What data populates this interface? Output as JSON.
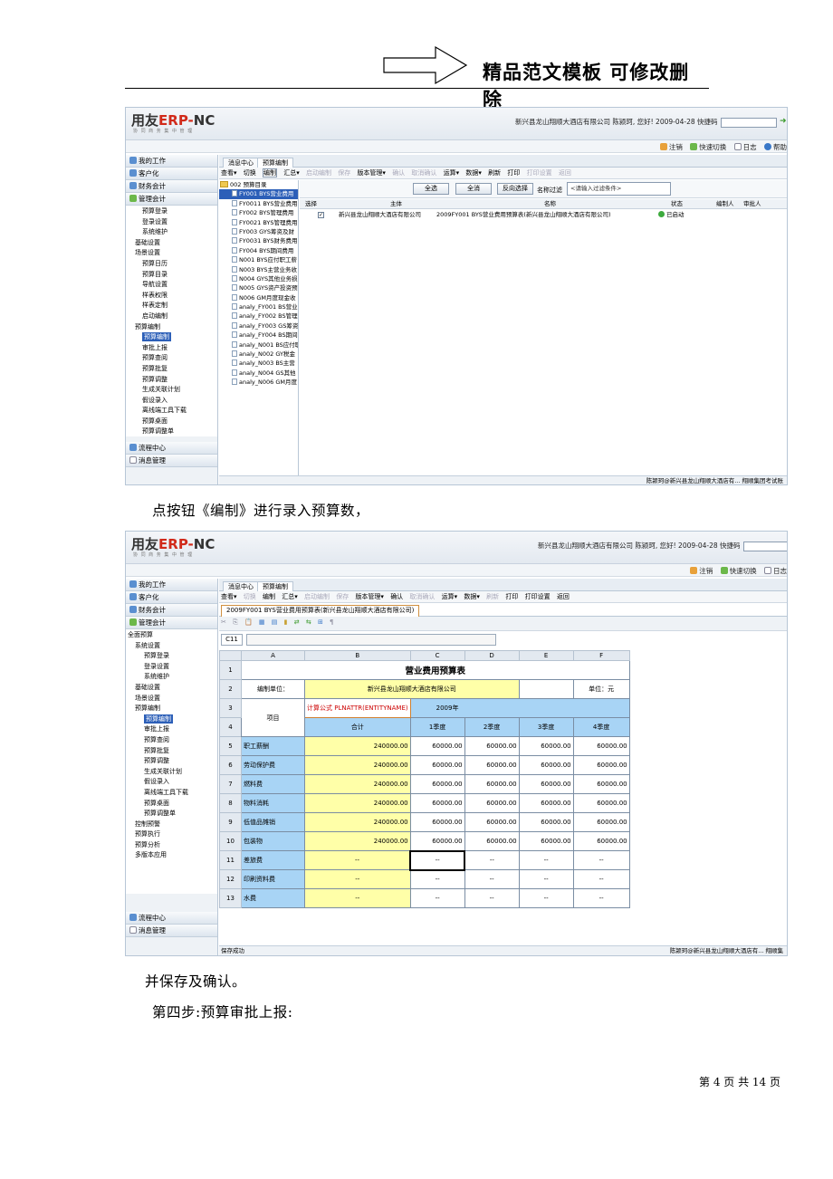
{
  "header": {
    "title": "精品范文模板 可修改删除"
  },
  "shot1": {
    "logo_main": "用友",
    "logo_erp": "ERP-",
    "logo_nc": "NC",
    "logo_sub": "协 同 商 务    集 中 管 理",
    "company": "新兴县龙山翔顺大酒店有限公司 陈颍珂, 您好! 2009-04-28  快捷码",
    "links": [
      "注销",
      "快速切换",
      "日志",
      "帮助"
    ],
    "nav_heads": [
      "我的工作",
      "客户化",
      "财务会计",
      "管理会计"
    ],
    "tree": [
      "预算登录",
      "登录设置",
      "系统维护",
      "基础设置",
      "场景设置",
      "预算日历",
      "预算目录",
      "导航设置",
      "样表权限",
      "样表定制",
      "启动编制",
      "预算编制",
      "预算编制",
      "审批上报",
      "预算查阅",
      "预算批复",
      "预算调整",
      "生成关联计划",
      "假设录入",
      "离线端工具下载",
      "预算桌面",
      "预算调整单"
    ],
    "nav_feet": [
      "流程中心",
      "消息管理"
    ],
    "tabs": [
      "消息中心",
      "预算编制"
    ],
    "toolbar": [
      "查看▾",
      "切换",
      "编制",
      "汇总▾",
      "启动编制",
      "保存",
      "版本管理▾",
      "确认",
      "取消确认",
      "运算▾",
      "数据▾",
      "刷新",
      "打印",
      "打印设置",
      "返回"
    ],
    "dir_root": "002 预算目录",
    "dirs": [
      "FY001 BYS营业费用",
      "FY0011 BYS营业费用",
      "FY002 BYS管理费用",
      "FY0021 BYS管理费用",
      "FY003 GYS筹资及财",
      "FY0031 BYS财务费用",
      "FY004 BYS期间费用",
      "N001 BYS应付职工薪",
      "N003 BYS主营业务收",
      "N004 GYS其他业务损",
      "N005 GYS资产投资预",
      "N006 GM月度现金收",
      "analy_FY001 BS营业",
      "analy_FY002 BS管理",
      "analy_FY003 GS筹资",
      "analy_FY004 BS期间",
      "analy_N001 BS应付职",
      "analy_N002 GY税金",
      "analy_N003 BS主营",
      "analy_N004 GS其他",
      "analy_N006 GM月度"
    ],
    "filter": {
      "btn_all": "全选",
      "btn_clear": "全消",
      "btn_inverse": "反向选择",
      "label": "名称过滤",
      "placeholder": "<请输入过滤条件>"
    },
    "list_headers": [
      "选择",
      "主体",
      "名称",
      "状态",
      "编制人",
      "审批人"
    ],
    "list_row": {
      "check": "✓",
      "entity": "新兴县龙山翔顺大酒店有限公司",
      "name": "2009FY001 BYS营业费用预算表(新兴县龙山翔顺大酒店有限公司)",
      "status": "已启动"
    },
    "status_right": "陈颍珂@新兴县龙山翔顺大酒店有...  翔顺集团考试账"
  },
  "caption1": "点按钮《编制》进行录入预算数，",
  "shot2": {
    "company": "新兴县龙山翔顺大酒店有限公司 陈颍珂, 您好! 2009-04-28  快捷码",
    "links": [
      "注销",
      "快速切换",
      "日志"
    ],
    "nav_heads": [
      "我的工作",
      "客户化",
      "财务会计",
      "管理会计"
    ],
    "tree": [
      "全面预算",
      "系统设置",
      "预算登录",
      "登录设置",
      "系统维护",
      "基础设置",
      "场景设置",
      "预算编制",
      "预算编制",
      "审批上报",
      "预算查阅",
      "预算批复",
      "预算调整",
      "生成关联计划",
      "假设录入",
      "离线端工具下载",
      "预算桌面",
      "预算调整单",
      "控制预警",
      "预算执行",
      "预算分析",
      "多版本应用"
    ],
    "nav_feet": [
      "流程中心",
      "消息管理"
    ],
    "tabs": [
      "消息中心",
      "预算编制"
    ],
    "toolbar": [
      "查看▾",
      "切换",
      "编制",
      "汇总▾",
      "启动编制",
      "保存",
      "版本管理▾",
      "确认",
      "取消确认",
      "运算▾",
      "数据▾",
      "刷新",
      "打印",
      "打印设置",
      "返回"
    ],
    "doc_tab": "2009FY001 BYS营业费用预算表(新兴县龙山翔顺大酒店有限公司)",
    "cell_ref": "C11",
    "cols": [
      "A",
      "B",
      "C",
      "D",
      "E",
      "F"
    ],
    "sheet_title": "营业费用预算表",
    "unit_label": "编制单位：",
    "unit_value": "新兴县龙山翔顺大酒店有限公司",
    "currency": "单位：元",
    "item_label": "项目",
    "formula_tag": "计算公式 PLNATTR(ENTITYNAME)",
    "year": "2009年",
    "periods": [
      "合计",
      "1季度",
      "2季度",
      "3季度",
      "4季度"
    ],
    "rows": [
      {
        "n": "5",
        "item": "职工薪酬",
        "vals": [
          "240000.00",
          "60000.00",
          "60000.00",
          "60000.00",
          "60000.00"
        ]
      },
      {
        "n": "6",
        "item": "劳动保护费",
        "vals": [
          "240000.00",
          "60000.00",
          "60000.00",
          "60000.00",
          "60000.00"
        ]
      },
      {
        "n": "7",
        "item": "燃料费",
        "vals": [
          "240000.00",
          "60000.00",
          "60000.00",
          "60000.00",
          "60000.00"
        ]
      },
      {
        "n": "8",
        "item": "物料消耗",
        "vals": [
          "240000.00",
          "60000.00",
          "60000.00",
          "60000.00",
          "60000.00"
        ]
      },
      {
        "n": "9",
        "item": "低值品摊销",
        "vals": [
          "240000.00",
          "60000.00",
          "60000.00",
          "60000.00",
          "60000.00"
        ]
      },
      {
        "n": "10",
        "item": "包装物",
        "vals": [
          "240000.00",
          "60000.00",
          "60000.00",
          "60000.00",
          "60000.00"
        ]
      },
      {
        "n": "11",
        "item": "差旅费",
        "vals": [
          "--",
          "--",
          "--",
          "--",
          "--"
        ]
      },
      {
        "n": "12",
        "item": "印刷资料费",
        "vals": [
          "--",
          "--",
          "--",
          "--",
          "--"
        ]
      },
      {
        "n": "13",
        "item": "水费",
        "vals": [
          "--",
          "--",
          "--",
          "--",
          "--"
        ]
      }
    ],
    "status_left": "保存成功",
    "status_right": "陈颍珂@新兴县龙山翔顺大酒店有...  翔顺集"
  },
  "caption2": "并保存及确认。",
  "caption3": "第四步:预算审批上报:",
  "page_number": "第 4 页 共 14 页"
}
